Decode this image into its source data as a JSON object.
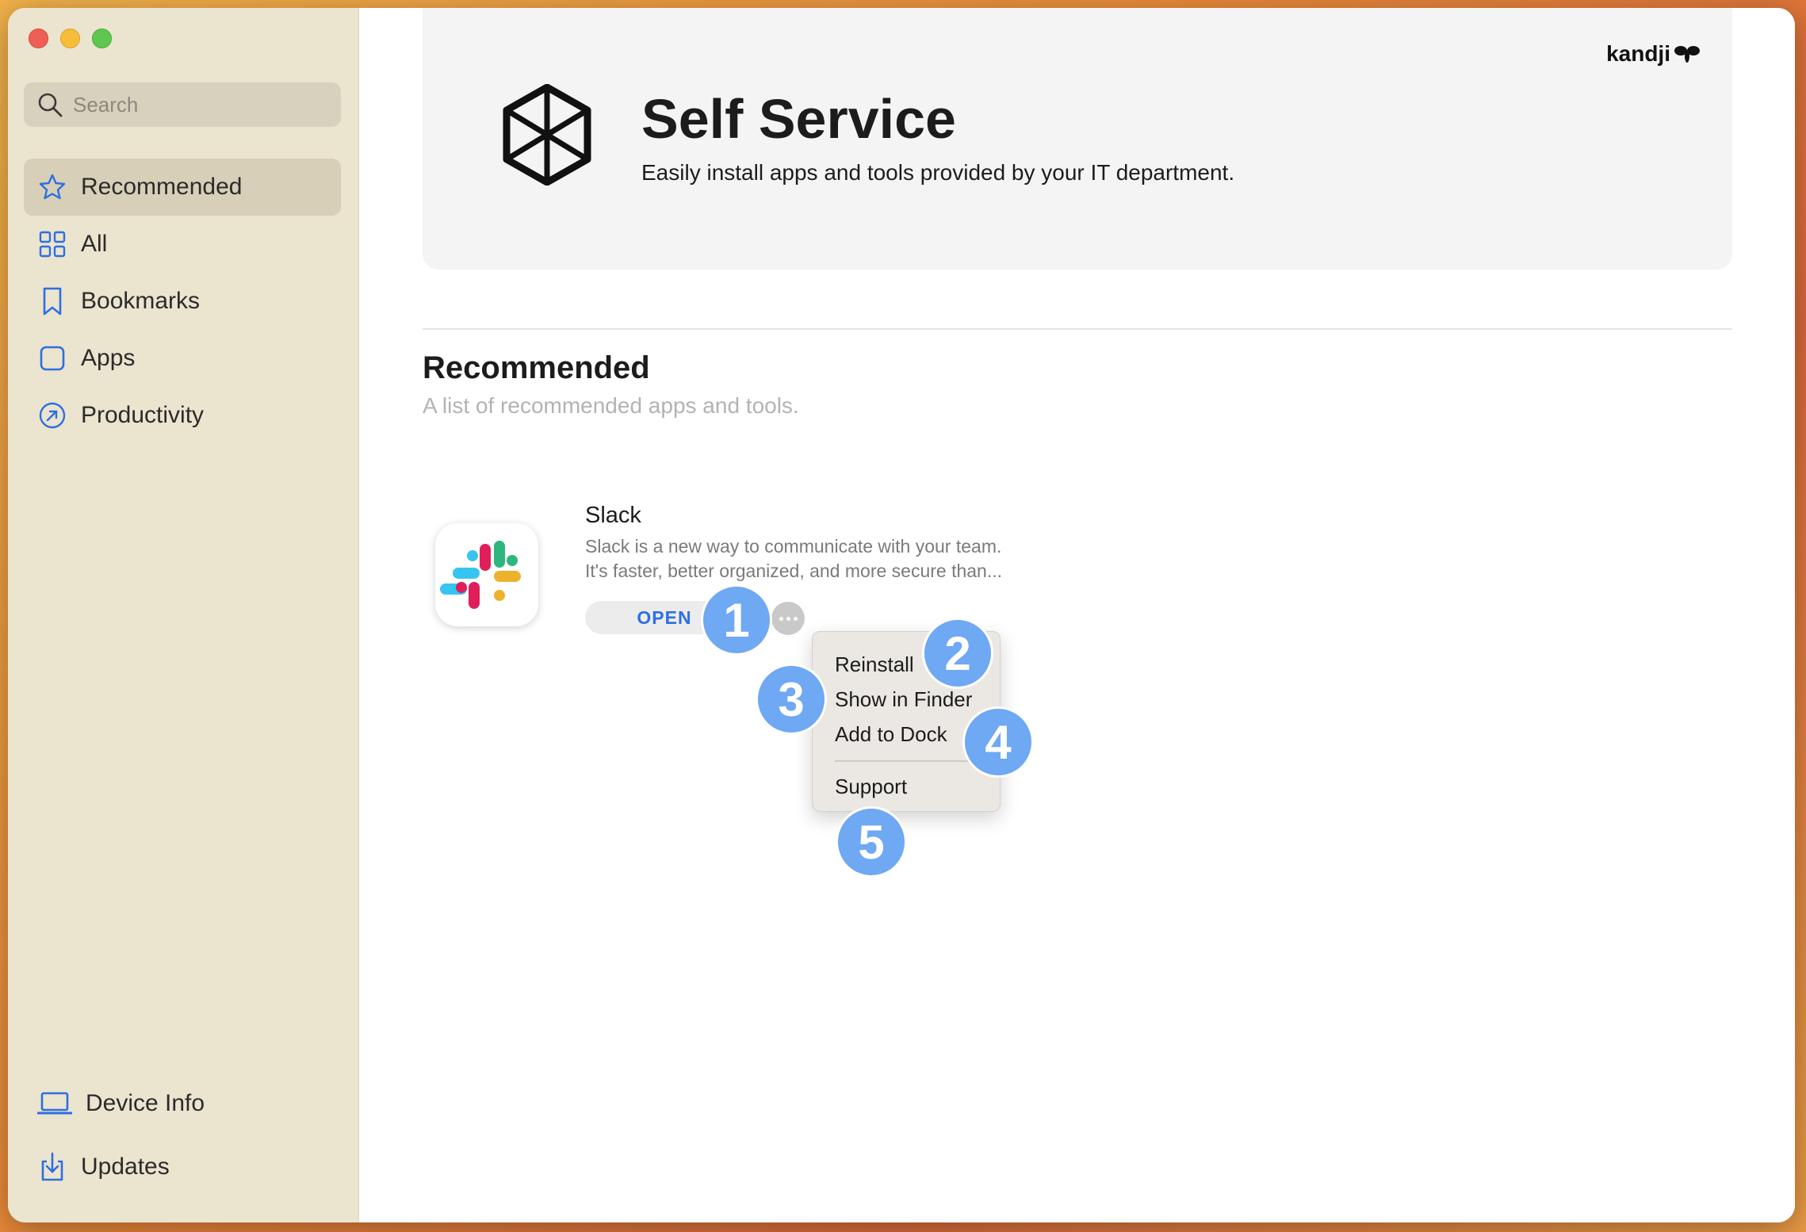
{
  "sidebar": {
    "search_placeholder": "Search",
    "items": [
      {
        "label": "Recommended",
        "icon": "star-icon"
      },
      {
        "label": "All",
        "icon": "grid-icon"
      },
      {
        "label": "Bookmarks",
        "icon": "bookmark-icon"
      },
      {
        "label": "Apps",
        "icon": "square-icon"
      },
      {
        "label": "Productivity",
        "icon": "arrow-circle-icon"
      }
    ],
    "bottom_items": [
      {
        "label": "Device Info",
        "icon": "laptop-icon"
      },
      {
        "label": "Updates",
        "icon": "download-icon"
      }
    ]
  },
  "header": {
    "title": "Self Service",
    "subtitle": "Easily install apps and tools provided by your IT department.",
    "brand": "kandji"
  },
  "section": {
    "title": "Recommended",
    "subtitle": "A list of recommended apps and tools."
  },
  "app": {
    "name": "Slack",
    "description_line1": "Slack is a new way to communicate with your team.",
    "description_line2": "It's faster, better organized, and more secure than...",
    "open_label": "OPEN"
  },
  "menu": {
    "items": [
      "Reinstall",
      "Show in Finder",
      "Add to Dock",
      "Support"
    ]
  },
  "badges": [
    "1",
    "2",
    "3",
    "4",
    "5"
  ],
  "colors": {
    "accent": "#2e6fe0",
    "sidebar_bg": "#ebe4cf",
    "badge": "#6fa8f3"
  }
}
